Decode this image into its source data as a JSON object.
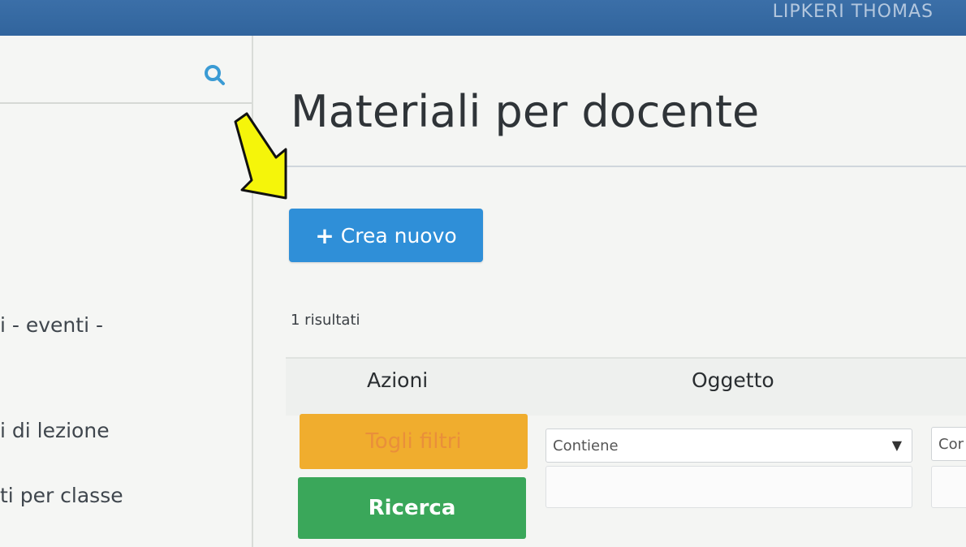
{
  "header": {
    "user_name": "LIPKERI THOMAS"
  },
  "sidebar": {
    "search_icon": "search-icon",
    "items": [
      {
        "label": "i - eventi -"
      },
      {
        "label": "i di lezione"
      },
      {
        "label": "ti per classe"
      }
    ]
  },
  "main": {
    "title": "Materiali per docente",
    "create_button": {
      "icon": "+",
      "label": "Crea nuovo"
    },
    "results_text": "1 risultati",
    "table": {
      "headers": [
        "Azioni",
        "Oggetto"
      ]
    },
    "clear_filters_label": "Togli filtri",
    "search_label": "Ricerca",
    "filter_select_value": "Contiene",
    "filter_select_value_2": "Cor"
  },
  "colors": {
    "topbar": "#2c5f97",
    "primary_button": "#2f8fd8",
    "warning_button": "#f0ad2e",
    "success_button": "#3aa75a",
    "annotation_arrow": "#f5f50a"
  }
}
